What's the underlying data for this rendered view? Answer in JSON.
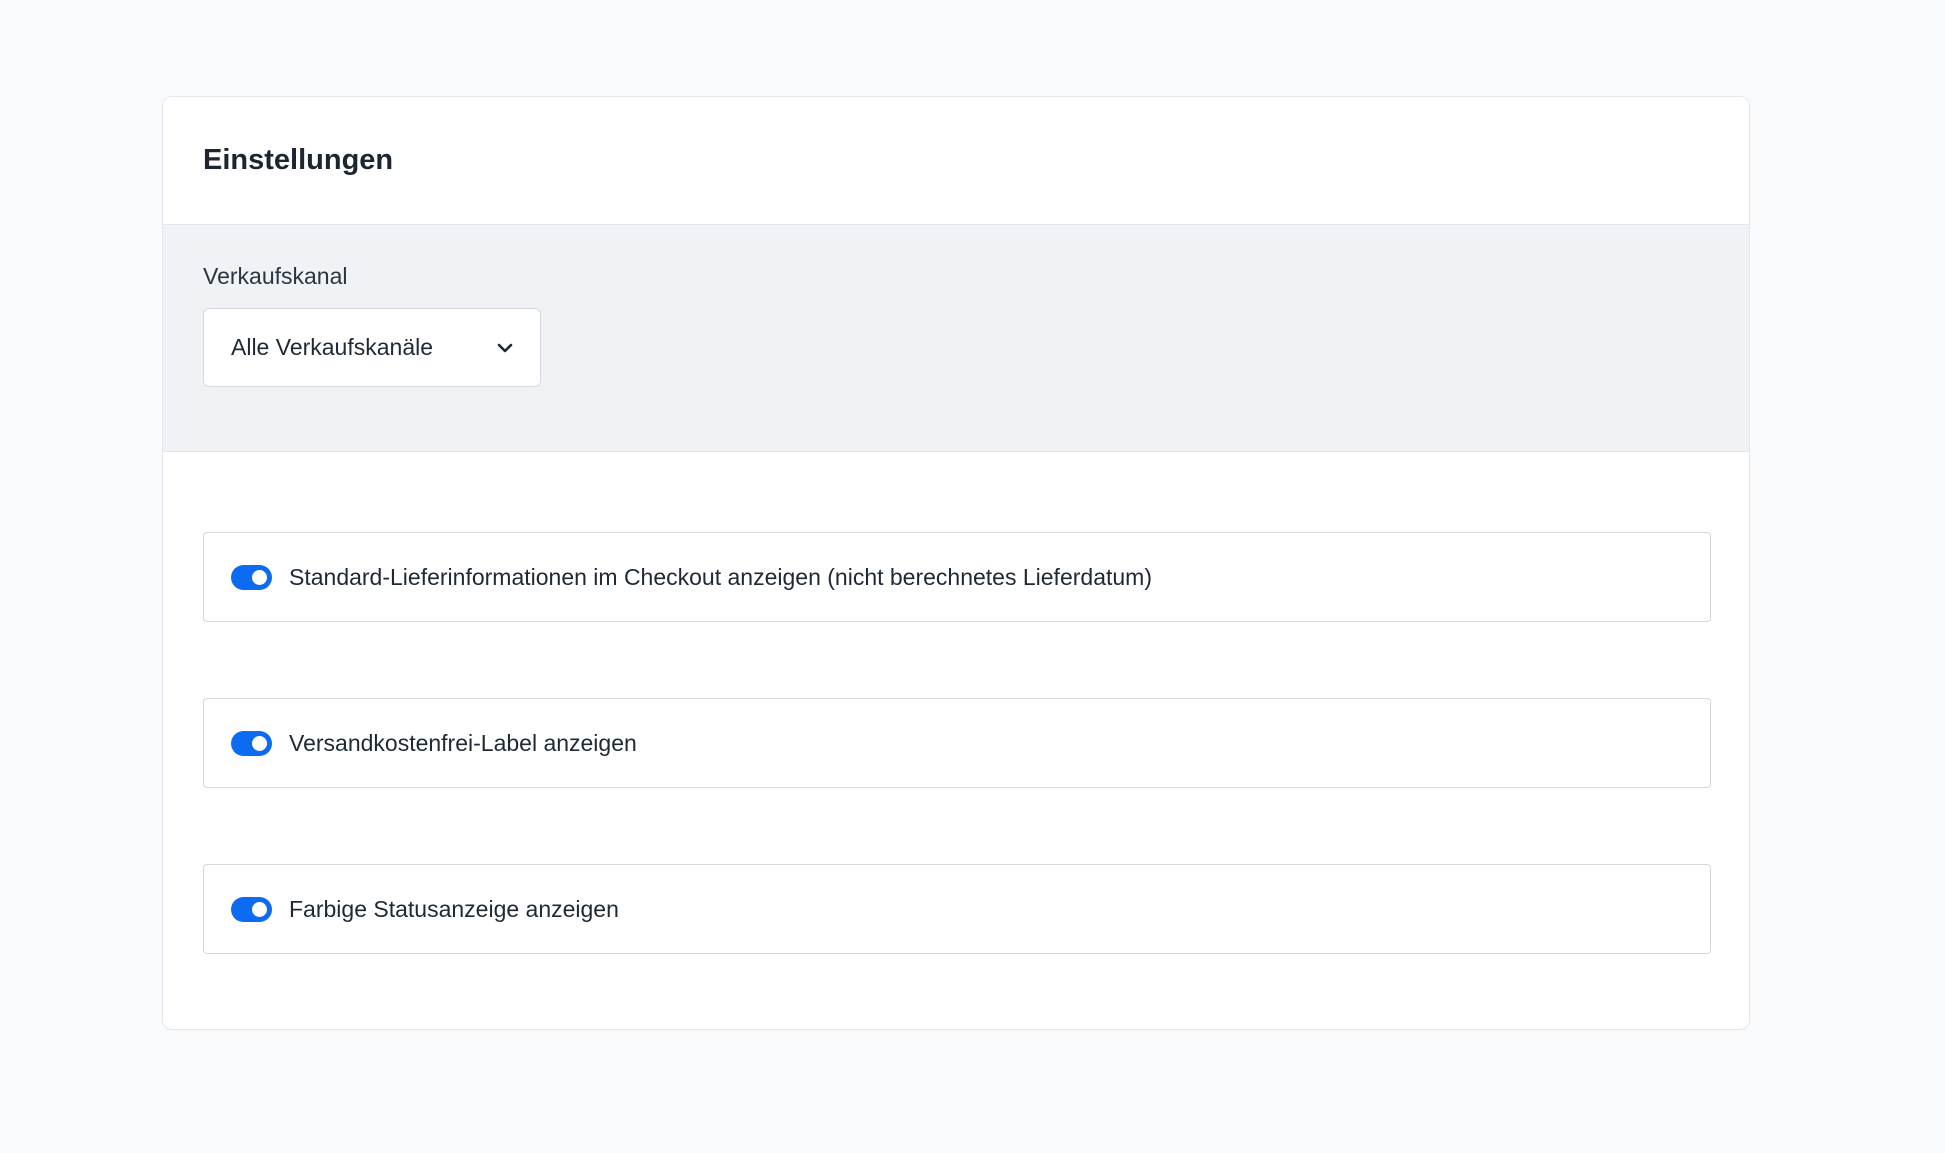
{
  "settings": {
    "title": "Einstellungen",
    "sales_channel": {
      "label": "Verkaufskanal",
      "selected": "Alle Verkaufskanäle",
      "icon": "chevron-down-icon"
    },
    "options": [
      {
        "label": "Standard-Lieferinformationen im Checkout anzeigen (nicht berechnetes Lieferdatum)",
        "enabled": true
      },
      {
        "label": "Versandkostenfrei-Label anzeigen",
        "enabled": true
      },
      {
        "label": "Farbige Statusanzeige anzeigen",
        "enabled": true
      }
    ]
  },
  "colors": {
    "toggle_on": "#0b6bf1",
    "page_background": "#f9fafc",
    "filter_background": "#f1f2f5"
  }
}
